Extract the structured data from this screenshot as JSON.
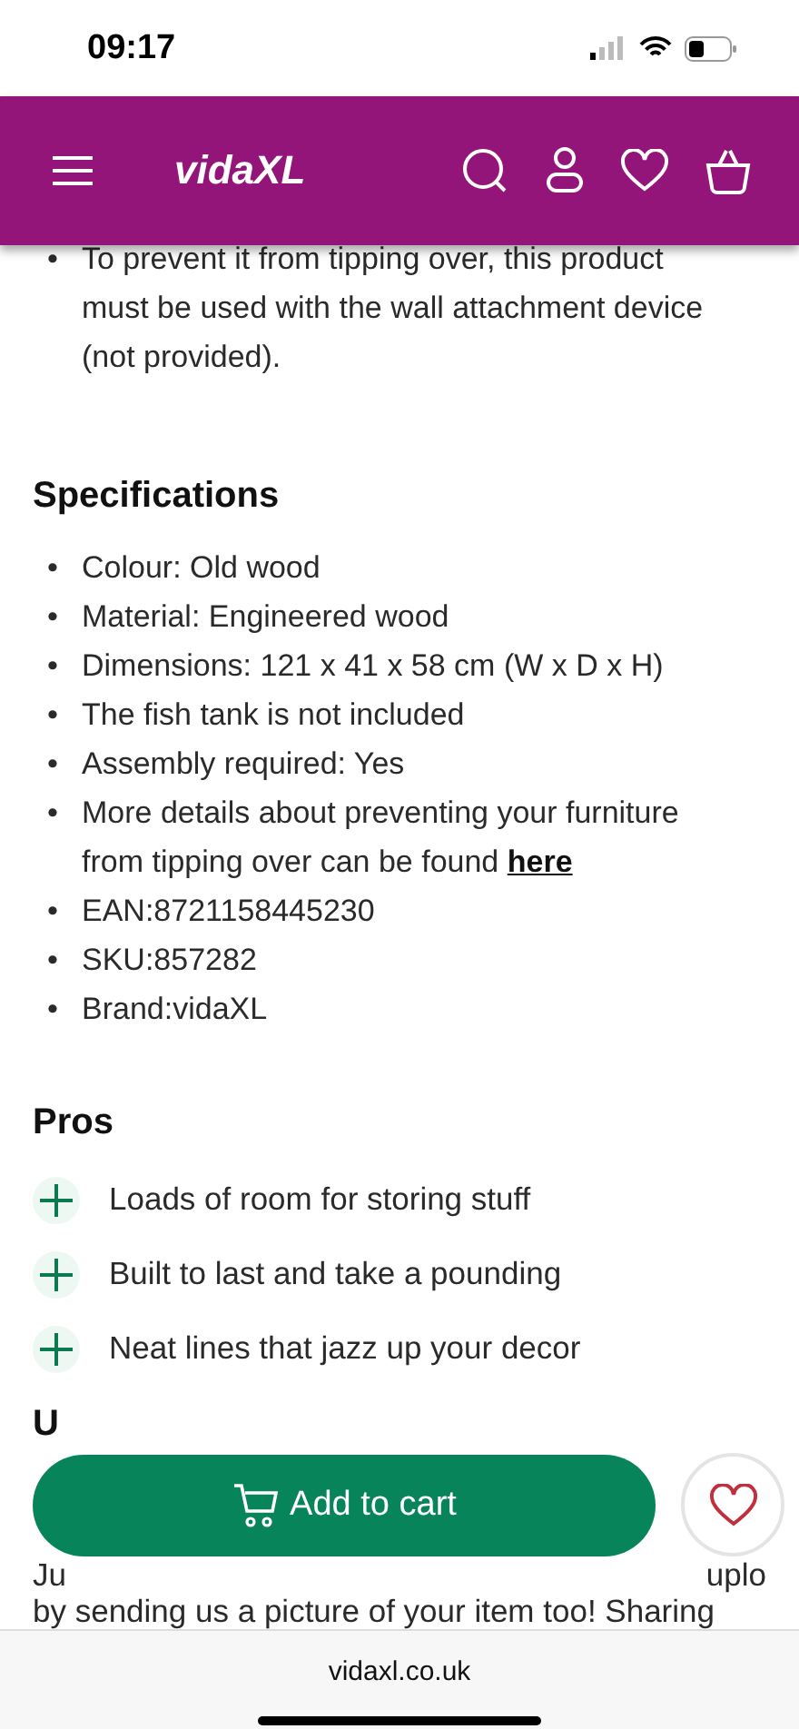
{
  "status_bar": {
    "time": "09:17"
  },
  "header": {
    "logo": "vidaXL"
  },
  "bullet_marker": "•",
  "intro_bullets": [
    "To prevent it from tipping over, this product must be used with the wall attachment device (not provided)."
  ],
  "specifications": {
    "title": "Specifications",
    "items": [
      {
        "text": "Colour: Old wood"
      },
      {
        "text": "Material: Engineered wood"
      },
      {
        "text": "Dimensions: 121 x 41 x 58 cm (W x D x H)"
      },
      {
        "text": "The fish tank is not included"
      },
      {
        "text": "Assembly required: Yes"
      },
      {
        "text": "More details about preventing your furniture from tipping over can be found",
        "link": "here"
      },
      {
        "text": "EAN:8721158445230"
      },
      {
        "text": "SKU:857282"
      },
      {
        "text": "Brand:vidaXL"
      }
    ]
  },
  "pros": {
    "title": "Pros",
    "items": [
      "Loads of room for storing stuff",
      "Built to last and take a pounding",
      "Neat lines that jazz up your decor"
    ]
  },
  "partial_section": {
    "heading": "U",
    "line_start": "Ju",
    "line_end": "uplo",
    "line": "by sending us a picture of your item too! Sharing"
  },
  "add_to_cart": {
    "label": "Add to cart"
  },
  "favourite": {
    "selected": false
  },
  "browser": {
    "url": "vidaxl.co.uk"
  }
}
